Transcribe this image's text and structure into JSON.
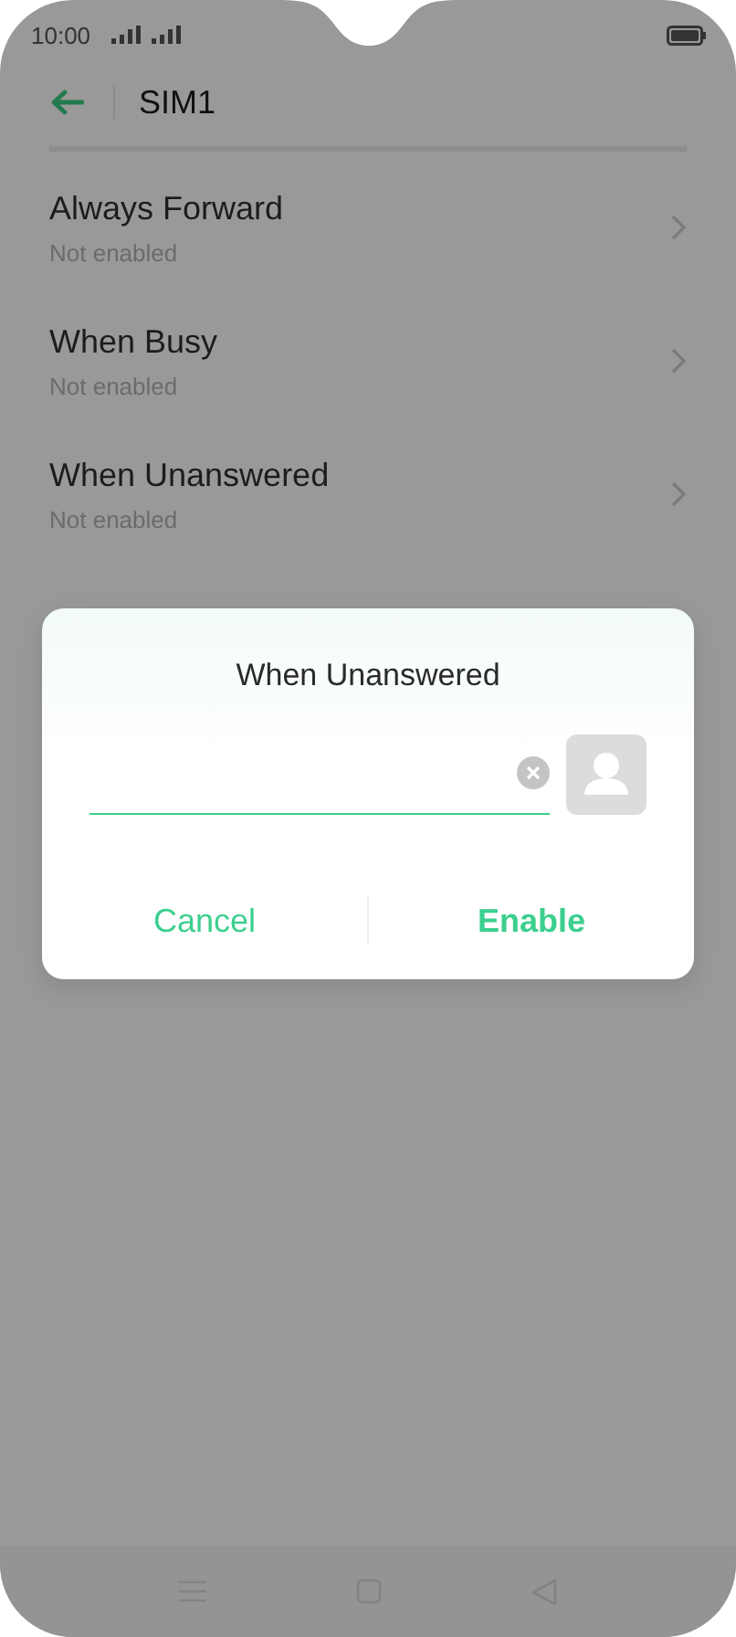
{
  "status_bar": {
    "time": "10:00"
  },
  "header": {
    "title": "SIM1"
  },
  "items": [
    {
      "title": "Always Forward",
      "subtitle": "Not enabled"
    },
    {
      "title": "When Busy",
      "subtitle": "Not enabled"
    },
    {
      "title": "When Unanswered",
      "subtitle": "Not enabled"
    }
  ],
  "dialog": {
    "title": "When Unanswered",
    "buttons": [
      {
        "label": "Cancel",
        "kind": "secondary"
      },
      {
        "label": "Enable",
        "kind": "primary"
      }
    ]
  }
}
